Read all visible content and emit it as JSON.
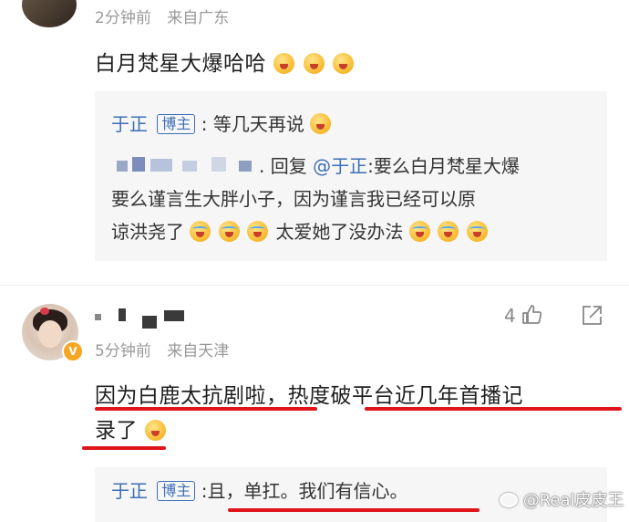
{
  "comment1": {
    "time": "2分钟前",
    "location": "来自广东",
    "text": "白月梵星大爆哈哈",
    "emojis": [
      "party-face-icon",
      "laugh-emoji-icon",
      "laugh-emoji-icon"
    ],
    "reply_block": {
      "reply1": {
        "author": "于正",
        "badge": "博主",
        "text": "等几天再说"
      },
      "reply2": {
        "prefix": ". 回复",
        "mention": "@于正",
        "line1": ":要么白月梵星大爆",
        "line2": "要么谨言生大胖小子，因为谨言我已经可以原",
        "line3": "谅洪尧了",
        "line3_end": "太爱她了没办法"
      }
    }
  },
  "comment2": {
    "likes": "4",
    "time": "5分钟前",
    "location": "来自天津",
    "text_line1": "因为白鹿太抗剧啦，热度破平台近几年首播记",
    "text_line2": "录了",
    "reply": {
      "author": "于正",
      "badge": "博主",
      "text": ":且，单扛。我们有信心。"
    }
  },
  "watermark": "@Real皮皮王",
  "colors": {
    "link_blue": "#3d6fb8",
    "underline_red": "#e0141b",
    "meta_gray": "#9a9a9a",
    "quote_bg": "#f6f6f6"
  }
}
